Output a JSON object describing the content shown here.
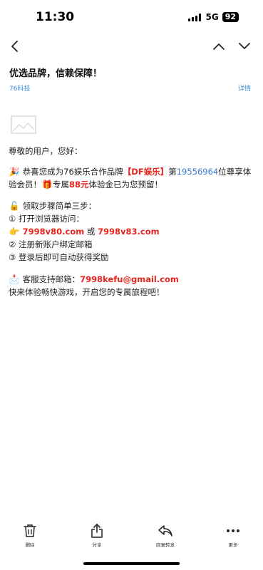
{
  "status": {
    "time": "11:30",
    "network": "5G",
    "battery": "92"
  },
  "email": {
    "subject": "优选品牌，信赖保障！",
    "sender": "76科技",
    "details_link": "详情"
  },
  "body": {
    "greeting": "尊敬的用户，您好：",
    "p1_emoji": "🎉",
    "p1_a": " 恭喜您成为76娱乐合作品牌",
    "p1_brand": "【DF娱乐】",
    "p1_b": "第",
    "p1_number": "19556964",
    "p1_c": "位尊享体验会员！",
    "p1_gift_emoji": "🎁",
    "p1_d": "专属",
    "p1_amount": "88元",
    "p1_e": "体验金已为您预留！",
    "steps_emoji": "🔓",
    "steps_title": " 领取步骤简单三步：",
    "step1": "① 打开浏览器访问：",
    "link_emoji": "👉",
    "url1": "7998v80.com",
    "or_text": " 或 ",
    "url2": "7998v83.com",
    "step2": "② 注册新账户绑定邮箱",
    "step3": "③ 登录后即可自动获得奖励",
    "support_emoji": "📩",
    "support_label": " 客服支持邮箱：",
    "support_email": "7998kefu@gmail.com",
    "closing": "快来体验畅快游戏，开启您的专属旅程吧！"
  },
  "toolbar": {
    "delete": "删除",
    "share": "分享",
    "forward": "回复转发",
    "more": "更多"
  }
}
